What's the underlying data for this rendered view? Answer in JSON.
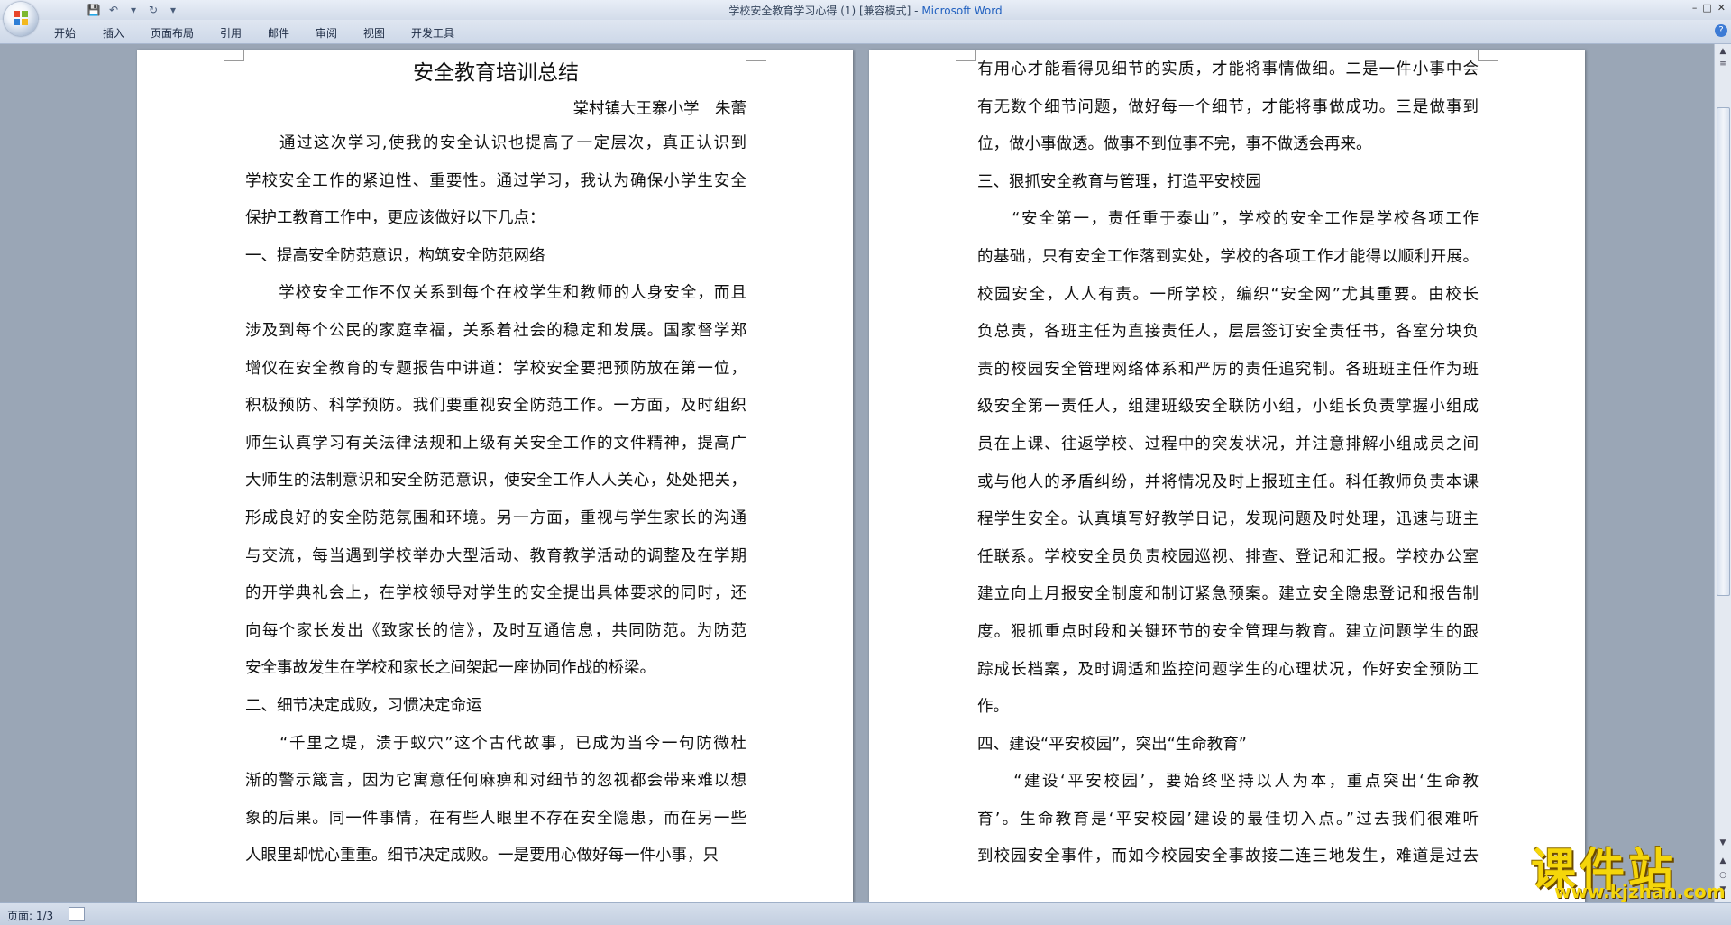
{
  "window": {
    "title": "学校安全教育学习心得 (1) [兼容模式] - Microsoft Word",
    "title_doc": "学校安全教育学习心得 (1) [兼容模式] - ",
    "title_app": "Microsoft Word"
  },
  "ribbon": {
    "tabs": [
      "开始",
      "插入",
      "页面布局",
      "引用",
      "邮件",
      "审阅",
      "视图",
      "开发工具"
    ]
  },
  "document": {
    "title": "安全教育培训总结",
    "author": "棠村镇大王寨小学　朱蕾",
    "left_lines": [
      "　　通过这次学习,使我的安全认识也提高了一定层次，真正认识到",
      "学校安全工作的紧迫性、重要性。通过学习，我认为确保小学生安全",
      "保护工教育工作中，更应该做好以下几点：",
      "一、提高安全防范意识，构筑安全防范网络",
      "　　学校安全工作不仅关系到每个在校学生和教师的人身安全，而且",
      "涉及到每个公民的家庭幸福，关系着社会的稳定和发展。国家督学郑",
      "增仪在安全教育的专题报告中讲道：学校安全要把预防放在第一位，",
      "积极预防、科学预防。我们要重视安全防范工作。一方面，及时组织",
      "师生认真学习有关法律法规和上级有关安全工作的文件精神，提高广",
      "大师生的法制意识和安全防范意识，使安全工作人人关心，处处把关，",
      "形成良好的安全防范氛围和环境。另一方面，重视与学生家长的沟通",
      "与交流，每当遇到学校举办大型活动、教育教学活动的调整及在学期",
      "的开学典礼会上，在学校领导对学生的安全提出具体要求的同时，还",
      "向每个家长发出《致家长的信》，及时互通信息，共同防范。为防范",
      "安全事故发生在学校和家长之间架起一座协同作战的桥梁。",
      "二、细节决定成败，习惯决定命运",
      "　　“千里之堤，溃于蚁穴”这个古代故事，已成为当今一句防微杜",
      "渐的警示箴言，因为它寓意任何麻痹和对细节的忽视都会带来难以想",
      "象的后果。同一件事情，在有些人眼里不存在安全隐患，而在另一些",
      "人眼里却忧心重重。细节决定成败。一是要用心做好每一件小事，只"
    ],
    "right_lines": [
      "有用心才能看得见细节的实质，才能将事情做细。二是一件小事中会",
      "有无数个细节问题，做好每一个细节，才能将事做成功。三是做事到",
      "位，做小事做透。做事不到位事不完，事不做透会再来。",
      "三、狠抓安全教育与管理，打造平安校园",
      "　　“安全第一，责任重于泰山”，学校的安全工作是学校各项工作",
      "的基础，只有安全工作落到实处，学校的各项工作才能得以顺利开展。",
      "校园安全，人人有责。一所学校，编织“安全网”尤其重要。由校长",
      "负总责，各班主任为直接责任人，层层签订安全责任书，各室分块负",
      "责的校园安全管理网络体系和严厉的责任追究制。各班班主任作为班",
      "级安全第一责任人，组建班级安全联防小组，小组长负责掌握小组成",
      "员在上课、往返学校、过程中的突发状况，并注意排解小组成员之间",
      "或与他人的矛盾纠纷，并将情况及时上报班主任。科任教师负责本课",
      "程学生安全。认真填写好教学日记，发现问题及时处理，迅速与班主",
      "任联系。学校安全员负责校园巡视、排查、登记和汇报。学校办公室",
      "建立向上月报安全制度和制订紧急预案。建立安全隐患登记和报告制",
      "度。狠抓重点时段和关键环节的安全管理与教育。建立问题学生的跟",
      "踪成长档案，及时调适和监控问题学生的心理状况，作好安全预防工",
      "作。",
      "四、建设“平安校园”，突出“生命教育”",
      "　　“建设‘平安校园’，要始终坚持以人为本，重点突出‘生命教",
      "育’。生命教育是‘平安校园’建设的最佳切入点。”过去我们很难听",
      "到校园安全事件，而如今校园安全事故接二连三地发生，难道是过去"
    ]
  },
  "status": {
    "page": "页面: 1/3"
  },
  "watermark": {
    "title": "课件站",
    "url": "www.kjzhan.com"
  },
  "colors": {
    "workspace": "#9aa6b6",
    "ribbon": "#cdd8e8",
    "title_app": "#1f5fbf",
    "watermark": "#f5d60a"
  }
}
